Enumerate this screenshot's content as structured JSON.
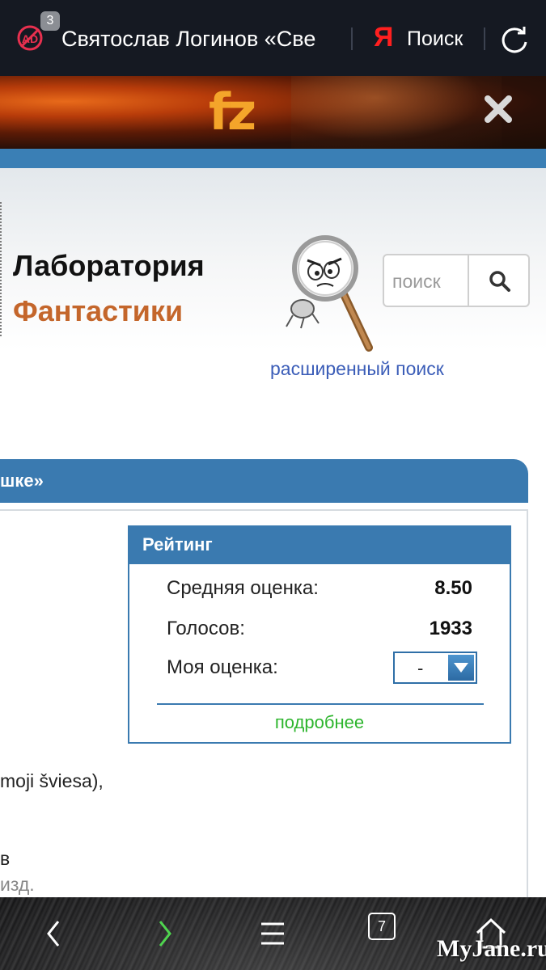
{
  "browser": {
    "adblock_icon": "adblock-icon",
    "adblock_count": "3",
    "tab_title": "Святослав Логинов «Све",
    "yandex_logo": "Я",
    "search_label": "Поиск",
    "reload_icon": "reload-icon"
  },
  "banner": {
    "logo": "fz",
    "close_icon": "close-icon"
  },
  "site": {
    "title_line1": "Лаборатория",
    "title_line2": "Фантастики",
    "search_placeholder": "поиск",
    "search_icon": "search-icon",
    "advanced_search": "расширенный поиск"
  },
  "section": {
    "header": "шке»"
  },
  "rating": {
    "title": "Рейтинг",
    "average_label": "Средняя оценка:",
    "average_value": "8.50",
    "votes_label": "Голосов:",
    "votes_value": "1933",
    "my_label": "Моя оценка:",
    "my_value": "-",
    "more": "подробнее"
  },
  "content": {
    "line1": "moji šviesa),",
    "line2": "в",
    "line3": "изд."
  },
  "bottom_nav": {
    "back_icon": "back-arrow-icon",
    "forward_icon": "forward-arrow-icon",
    "menu_icon": "menu-icon",
    "tabs_count": "7",
    "home_icon": "home-icon",
    "watermark": "MyJane.ru"
  },
  "colors": {
    "accent_blue": "#3a7ab0",
    "title_orange": "#c4662b",
    "link_blue": "#3b5db8",
    "more_green": "#2db52d",
    "yandex_red": "#ff1f1f"
  }
}
